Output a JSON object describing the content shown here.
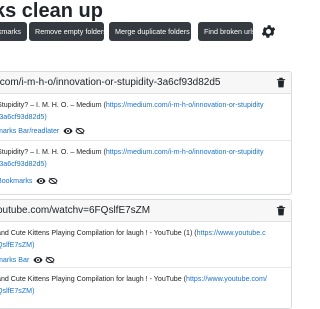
{
  "page": {
    "title": "ks clean up"
  },
  "toolbar": {
    "bookmarks_label": "kmarks",
    "remove_empty_label": "Remove empty folders",
    "merge_duplicate_label": "Merge duplicate folders",
    "find_broken_label": "Find broken urls",
    "settings_icon": "gear-icon"
  },
  "groups": [
    {
      "url": ".com/i-m-h-o/innovation-or-stupidity-3a6cf93d82d5",
      "items": [
        {
          "title_prefix": "Stupidity? – I. M. H. O. – Medium (",
          "link": "https://medium.com/i-m-h-o/innovation-or-stupidity",
          "link_cont": "-3a6cf93d82d5)",
          "folder": "marks Bar/readlater"
        },
        {
          "title_prefix": "Stupidity? – I. M. H. O. – Medium (",
          "link": "https://medium.com/i-m-h-o/innovation-or-stupidity",
          "link_cont": "-3a6cf93d82d5)",
          "folder": "Bookmarks"
        }
      ]
    },
    {
      "url": "outube.com/watchv=6FQslfE7sZM",
      "items": [
        {
          "title_prefix": "and Cute Kittens Playing Compilation for laugh ! - YouTube (1) (",
          "link": "https://www.youtube.c",
          "link_cont": "QslfE7sZM)",
          "folder": "marks Bar"
        },
        {
          "title_prefix": "and Cute Kittens Playing Compilation for laugh ! - YouTube (",
          "link": "https://www.youtube.com/",
          "link_cont": "QslfE7sZM)",
          "folder": ""
        }
      ]
    }
  ]
}
